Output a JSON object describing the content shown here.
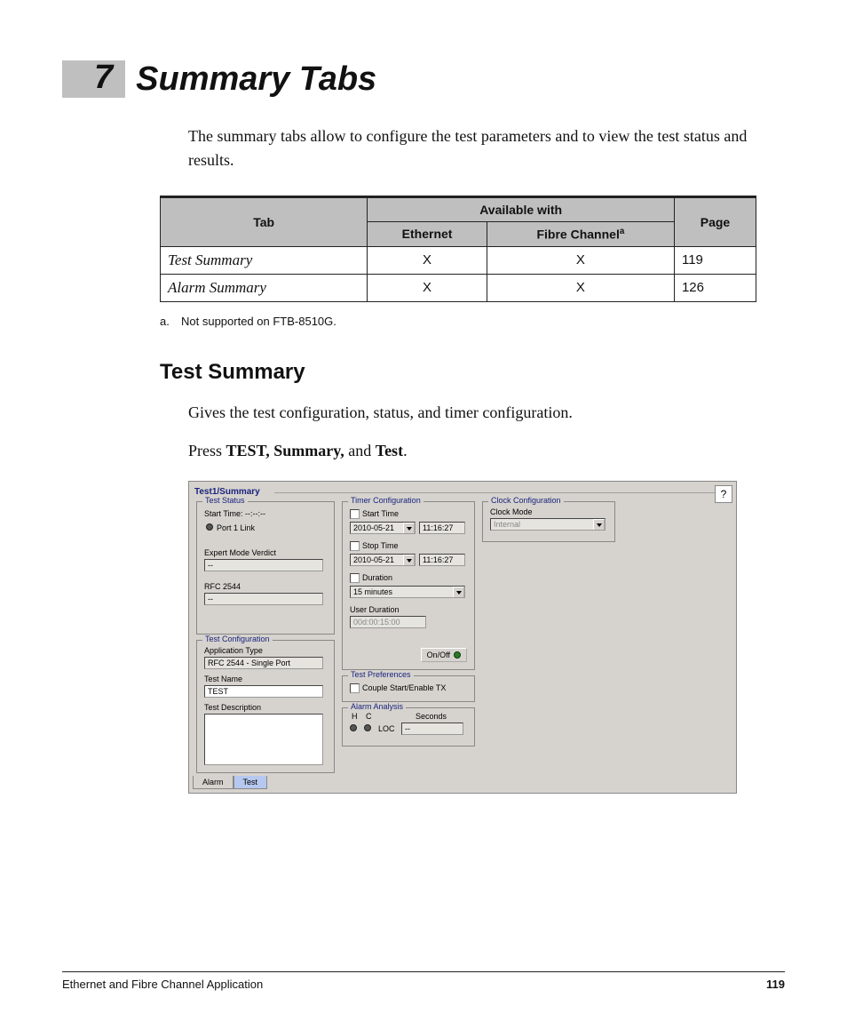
{
  "chapter": {
    "number": "7",
    "title": "Summary Tabs"
  },
  "intro": "The summary tabs allow to configure the test parameters and to view the test status and results.",
  "table": {
    "headers": {
      "tab": "Tab",
      "available": "Available with",
      "eth": "Ethernet",
      "fc": "Fibre Channel",
      "fc_sup": "a",
      "page": "Page"
    },
    "rows": [
      {
        "tab": "Test Summary",
        "eth": "X",
        "fc": "X",
        "page": "119"
      },
      {
        "tab": "Alarm Summary",
        "eth": "X",
        "fc": "X",
        "page": "126"
      }
    ]
  },
  "footnote": {
    "marker": "a.",
    "text": "Not supported on FTB-8510G."
  },
  "section": {
    "title": "Test Summary",
    "desc": "Gives the test configuration, status, and timer configuration.",
    "press_prefix": "Press ",
    "press_bold1": "TEST, Summary,",
    "press_mid": " and ",
    "press_bold2": "Test",
    "press_suffix": "."
  },
  "shot": {
    "path": "Test1/Summary",
    "help_icon": "?",
    "test_status": {
      "legend": "Test Status",
      "start_time_label": "Start Time:",
      "start_time_value": "--:--:--",
      "port_link": "Port 1 Link",
      "expert_label": "Expert Mode Verdict",
      "expert_value": "--",
      "rfc_label": "RFC 2544",
      "rfc_value": "--"
    },
    "test_config": {
      "legend": "Test Configuration",
      "app_type_label": "Application Type",
      "app_type_value": "RFC 2544 - Single Port",
      "test_name_label": "Test Name",
      "test_name_value": "TEST",
      "test_desc_label": "Test Description"
    },
    "timer": {
      "legend": "Timer Configuration",
      "start_label": "Start Time",
      "start_date": "2010-05-21",
      "start_t": "11:16:27",
      "stop_label": "Stop Time",
      "stop_date": "2010-05-21",
      "stop_t": "11:16:27",
      "dur_label": "Duration",
      "dur_value": "15 minutes",
      "user_dur_label": "User Duration",
      "user_dur_value": "00d:00:15:00",
      "onoff": "On/Off"
    },
    "prefs": {
      "legend": "Test Preferences",
      "couple": "Couple Start/Enable TX"
    },
    "alarm": {
      "legend": "Alarm Analysis",
      "h": "H",
      "c": "C",
      "loc": "LOC",
      "seconds": "Seconds",
      "sec_value": "--"
    },
    "clock": {
      "legend": "Clock Configuration",
      "mode_label": "Clock Mode",
      "mode_value": "Internal"
    },
    "tabs": {
      "alarm": "Alarm",
      "test": "Test"
    }
  },
  "footer": {
    "app": "Ethernet and Fibre Channel Application",
    "page": "119"
  }
}
